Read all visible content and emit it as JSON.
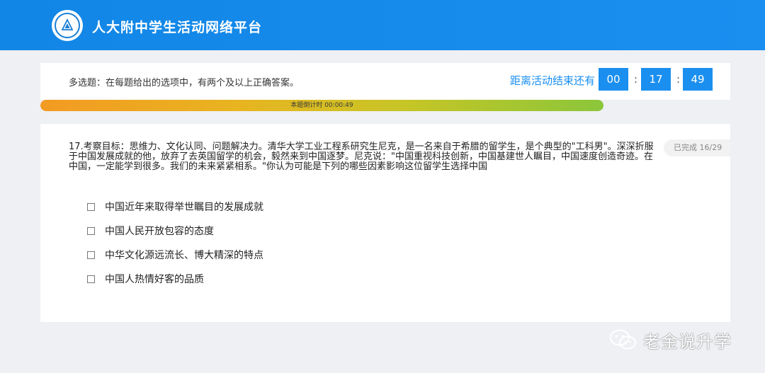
{
  "header": {
    "title": "人大附中学生活动网络平台"
  },
  "instruction": "多选题：在每题给出的选项中，有两个及以上正确答案。",
  "countdown": {
    "label": "距离活动结束还有",
    "hours": "00",
    "minutes": "17",
    "seconds": "49",
    "separator": ":"
  },
  "timer_bar": {
    "text": "本题倒计时 00:00:49",
    "fill_fraction": 1.0
  },
  "question": {
    "text": "17.考察目标：思维力、文化认同、问题解决力。清华大学工业工程系研究生尼克，是一名来自于希腊的留学生，是个典型的\"工科男\"。深深折服于中国发展成就的他，放弃了去英国留学的机会，毅然来到中国逐梦。尼克说：\"中国重视科技创新，中国基建世人瞩目，中国速度创造奇迹。在中国，一定能学到很多。我们的未来紧紧相系。\"你认为可能是下列的哪些因素影响这位留学生选择中国",
    "completed": "已完成 16/29",
    "options": [
      "中国近年来取得举世瞩目的发展成就",
      "中国人民开放包容的态度",
      "中华文化源远流长、博大精深的特点",
      "中国人热情好客的品质"
    ]
  },
  "watermark": {
    "text": "老金说升学"
  },
  "colors": {
    "header": "#1a8ff0",
    "accent": "#1a8ff0",
    "progress_start": "#f39a22",
    "progress_end": "#8bc63a"
  }
}
